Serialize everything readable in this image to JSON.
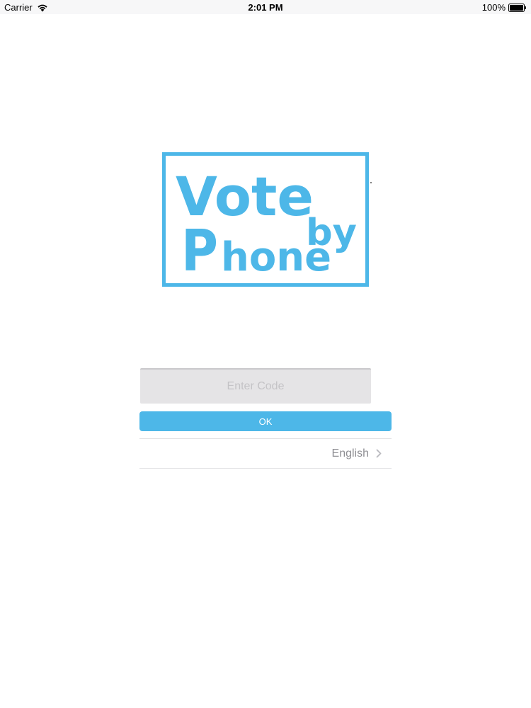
{
  "status_bar": {
    "carrier": "Carrier",
    "time": "2:01 PM",
    "battery": "100%"
  },
  "logo": {
    "word1": "Vote",
    "word2": "by",
    "word3_initial": "P",
    "word3_rest": "hone",
    "color": "#4db7e8"
  },
  "login": {
    "code_placeholder": "Enter Code",
    "code_value": "",
    "ok_label": "OK"
  },
  "language": {
    "selected": "English"
  },
  "colors": {
    "accent": "#4db7e8",
    "input_bg": "#e5e4e6",
    "secondary_text": "#8e8e93"
  }
}
